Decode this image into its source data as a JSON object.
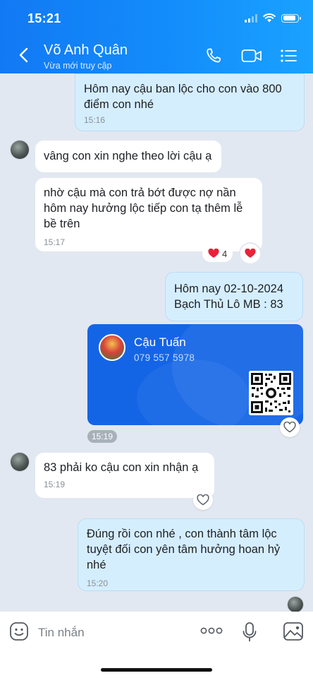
{
  "status_bar": {
    "time": "15:21"
  },
  "header": {
    "contact_name": "Võ Anh Quân",
    "status": "Vừa mới truy cập"
  },
  "messages": [
    {
      "id": "m1",
      "direction": "outgoing",
      "text": "Hôm nay cậu ban lộc cho con vào 800 điểm con nhé",
      "time": "15:16"
    },
    {
      "id": "m2",
      "direction": "incoming",
      "text": "vâng con xin nghe theo lời cậu ạ"
    },
    {
      "id": "m3",
      "direction": "incoming",
      "text": "nhờ cậu mà con trả bớt được nợ nần hôm nay hưởng lộc tiếp con tạ thêm lễ bề trên",
      "time": "15:17",
      "reaction_count": "4"
    },
    {
      "id": "m4",
      "direction": "outgoing",
      "line1": "Hôm nay 02-10-2024",
      "line2": "Bạch Thủ Lô MB : 83"
    },
    {
      "id": "m5",
      "direction": "outgoing",
      "type": "contact_card",
      "card_name": "Cậu Tuấn",
      "card_phone": "079 557 5978",
      "time": "15:19"
    },
    {
      "id": "m6",
      "direction": "incoming",
      "text": "83 phải ko cậu con xin nhận ạ",
      "time": "15:19"
    },
    {
      "id": "m7",
      "direction": "outgoing",
      "text": "Đúng rồi con nhé , con thành tâm lộc tuyệt đối con yên tâm hưởng hoan hỷ nhé",
      "time": "15:20"
    }
  ],
  "composer": {
    "placeholder": "Tin nhắn"
  },
  "colors": {
    "header_blue": "#1383f7",
    "outgoing_bubble": "#d5eefe",
    "incoming_bubble": "#ffffff",
    "card_blue": "#1465e6",
    "heart_red": "#e8223a"
  }
}
